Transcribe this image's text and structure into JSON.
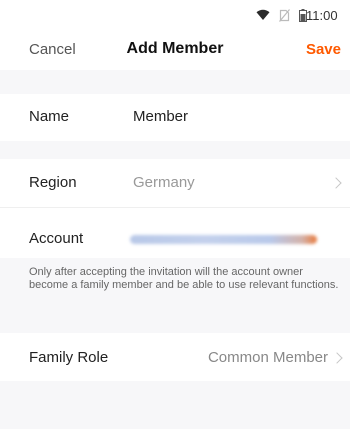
{
  "status_bar": {
    "time": "11:00",
    "icons": [
      "wifi-icon",
      "no-sim-icon",
      "battery-icon"
    ]
  },
  "nav": {
    "cancel_label": "Cancel",
    "title": "Add Member",
    "save_label": "Save"
  },
  "form": {
    "name": {
      "label": "Name",
      "value": "Member"
    },
    "region": {
      "label": "Region",
      "value": "Germany"
    },
    "account": {
      "label": "Account",
      "value_obscured": true
    },
    "note": "Only after accepting the invitation will the account owner become a family member and be able to use relevant functions.",
    "family_role": {
      "label": "Family Role",
      "value": "Common Member"
    }
  },
  "colors": {
    "accent": "#ff5a00",
    "page_background": "#f7f7f9",
    "card_background": "#ffffff"
  }
}
